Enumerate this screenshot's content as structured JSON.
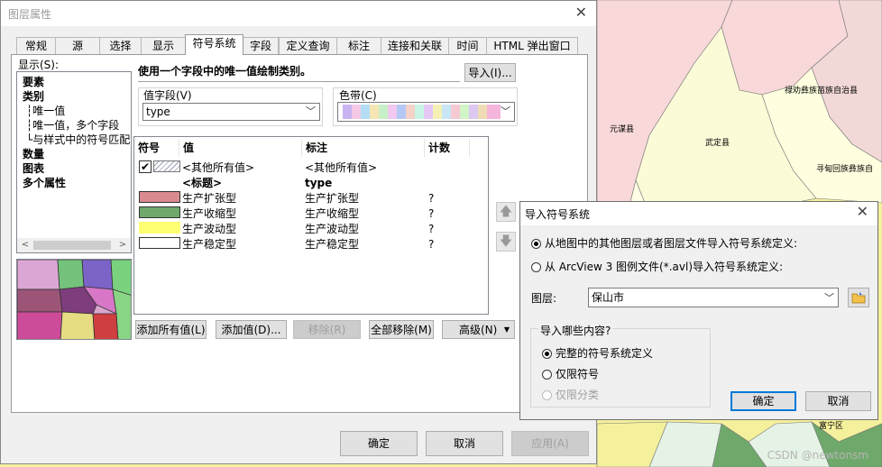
{
  "layer_properties": {
    "title": "图层属性",
    "tabs": [
      {
        "label": "常规"
      },
      {
        "label": "源"
      },
      {
        "label": "选择"
      },
      {
        "label": "显示"
      },
      {
        "label": "符号系统"
      },
      {
        "label": "字段"
      },
      {
        "label": "定义查询"
      },
      {
        "label": "标注"
      },
      {
        "label": "连接和关联"
      },
      {
        "label": "时间"
      },
      {
        "label": "HTML 弹出窗口"
      }
    ],
    "active_tab": "符号系统",
    "show_label": "显示(S):",
    "tree": [
      {
        "label": "要素",
        "bold": true
      },
      {
        "label": "类别",
        "bold": true
      },
      {
        "label": "唯一值",
        "bold": false,
        "selected": true
      },
      {
        "label": "唯一值，多个字段",
        "bold": false
      },
      {
        "label": "与样式中的符号匹配",
        "bold": false
      },
      {
        "label": "数量",
        "bold": true
      },
      {
        "label": "图表",
        "bold": true
      },
      {
        "label": "多个属性",
        "bold": true
      }
    ],
    "description": "使用一个字段中的唯一值绘制类别。",
    "import_button": "导入(I)...",
    "value_field_label": "值字段(V)",
    "value_field_value": "type",
    "color_ramp_label": "色带(C)",
    "table": {
      "headers": [
        "符号",
        "值",
        "标注",
        "计数"
      ],
      "rows": [
        {
          "value": "<其他所有值>",
          "label": "<其他所有值>",
          "count": "",
          "color": "#ffffff",
          "checked": true,
          "hatched": true
        },
        {
          "value": "<标题>",
          "label": "type",
          "count": "",
          "heading": true
        },
        {
          "value": "生产扩张型",
          "label": "生产扩张型",
          "count": "?",
          "color": "#d98a8e"
        },
        {
          "value": "生产收缩型",
          "label": "生产收缩型",
          "count": "?",
          "color": "#6fa86b"
        },
        {
          "value": "生产波动型",
          "label": "生产波动型",
          "count": "?",
          "color": "#ffff73"
        },
        {
          "value": "生产稳定型",
          "label": "生产稳定型",
          "count": "?",
          "color": "#ffffff"
        }
      ]
    },
    "buttons": {
      "add_all": "添加所有值(L)",
      "add_values": "添加值(D)...",
      "remove": "移除(R)",
      "remove_all": "全部移除(M)",
      "advanced": "高级(N)"
    },
    "footer": {
      "ok": "确定",
      "cancel": "取消",
      "apply": "应用(A)"
    }
  },
  "import_dialog": {
    "title": "导入符号系统",
    "option_layer": "从地图中的其他图层或者图层文件导入符号系统定义:",
    "option_avl": "从 ArcView 3 图例文件(*.avl)导入符号系统定义:",
    "layer_label": "图层:",
    "layer_value": "保山市",
    "what_label": "导入哪些内容?",
    "opt_complete": "完整的符号系统定义",
    "opt_symbols_only": "仅限符号",
    "opt_classes_only": "仅限分类",
    "ok": "确定",
    "cancel": "取消"
  },
  "map_labels": [
    "禄劝彝族苗族自治县",
    "元谋县",
    "武定县",
    "寻甸回族彝族自",
    "富宁区"
  ],
  "watermark": "CSDN @newtonsm"
}
